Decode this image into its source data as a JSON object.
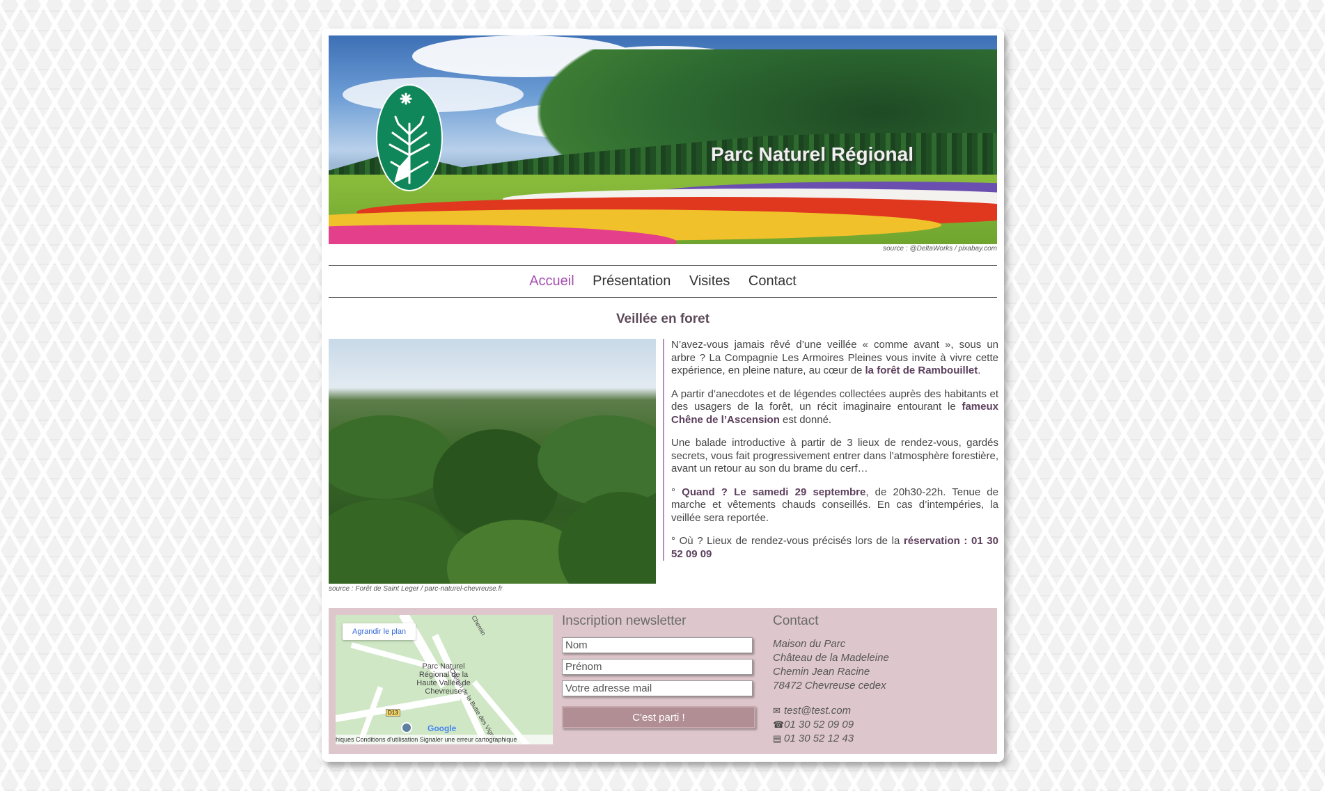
{
  "banner": {
    "title": "Parc Naturel Régional",
    "source": "source : @DeltaWorks / pixabay.com"
  },
  "nav": {
    "items": [
      {
        "label": "Accueil",
        "active": true
      },
      {
        "label": "Présentation",
        "active": false
      },
      {
        "label": "Visites",
        "active": false
      },
      {
        "label": "Contact",
        "active": false
      }
    ]
  },
  "article": {
    "title": "Veillée en foret",
    "image_source": "source : Forêt de Saint Leger / parc-naturel-chevreuse.fr",
    "p1_a": "N’avez-vous jamais rêvé d’une veillée « comme avant », sous un arbre ? La Compagnie Les Armoires Pleines vous invite à vivre cette expérience, en pleine nature, au cœur de ",
    "p1_b": "la forêt de Rambouillet",
    "p1_c": ".",
    "p2_a": "A partir d’anecdotes et de légendes collectées auprès des habitants et des usagers de la forêt, un récit imaginaire entourant le ",
    "p2_b": "fameux Chêne de l’Ascension",
    "p2_c": " est donné.",
    "p3": "Une balade introductive à partir de 3 lieux de rendez-vous, gardés secrets, vous fait progressivement entrer dans l’atmosphère forestière, avant un retour au son du brame du cerf…",
    "p4_a": "° ",
    "p4_b": "Quand ? Le samedi 29 septembre",
    "p4_c": ", de 20h30-22h. Tenue de marche et vêtements chauds conseillés. En cas d’intempéries, la veillée sera reportée.",
    "p5_a": "° Où ? Lieux de rendez-vous précisés lors de la ",
    "p5_b": "réservation : 01 30 52 09 09"
  },
  "map": {
    "enlarge": "Agrandir le plan",
    "label": "Parc Naturel Régional de la Haute Vallée de Chevreuse",
    "road_chemin": "Chemin",
    "road_butte": "Chemin de la Butte des Vignes",
    "shield": "D13",
    "google": "Google",
    "footer": "hiques   Conditions d'utilisation   Signaler une erreur cartographique"
  },
  "newsletter": {
    "title": "Inscription newsletter",
    "nom_placeholder": "Nom",
    "prenom_placeholder": "Prénom",
    "email_placeholder": "Votre adresse mail",
    "submit": "C'est parti !"
  },
  "contact": {
    "title": "Contact",
    "address": [
      "Maison du Parc",
      "Château de la Madeleine",
      "Chemin Jean Racine",
      "78472 Chevreuse cedex"
    ],
    "email": "test@test.com",
    "phone": "01 30 52 09 09",
    "fax": "01 30 52 12 43",
    "icons": [
      "envelope-icon",
      "phone-icon",
      "fax-icon"
    ]
  },
  "colors": {
    "accent": "#a54fb0",
    "footer_bg": "#dec7cc",
    "button_bg": "#b18e94",
    "logo_green": "#10875a"
  }
}
